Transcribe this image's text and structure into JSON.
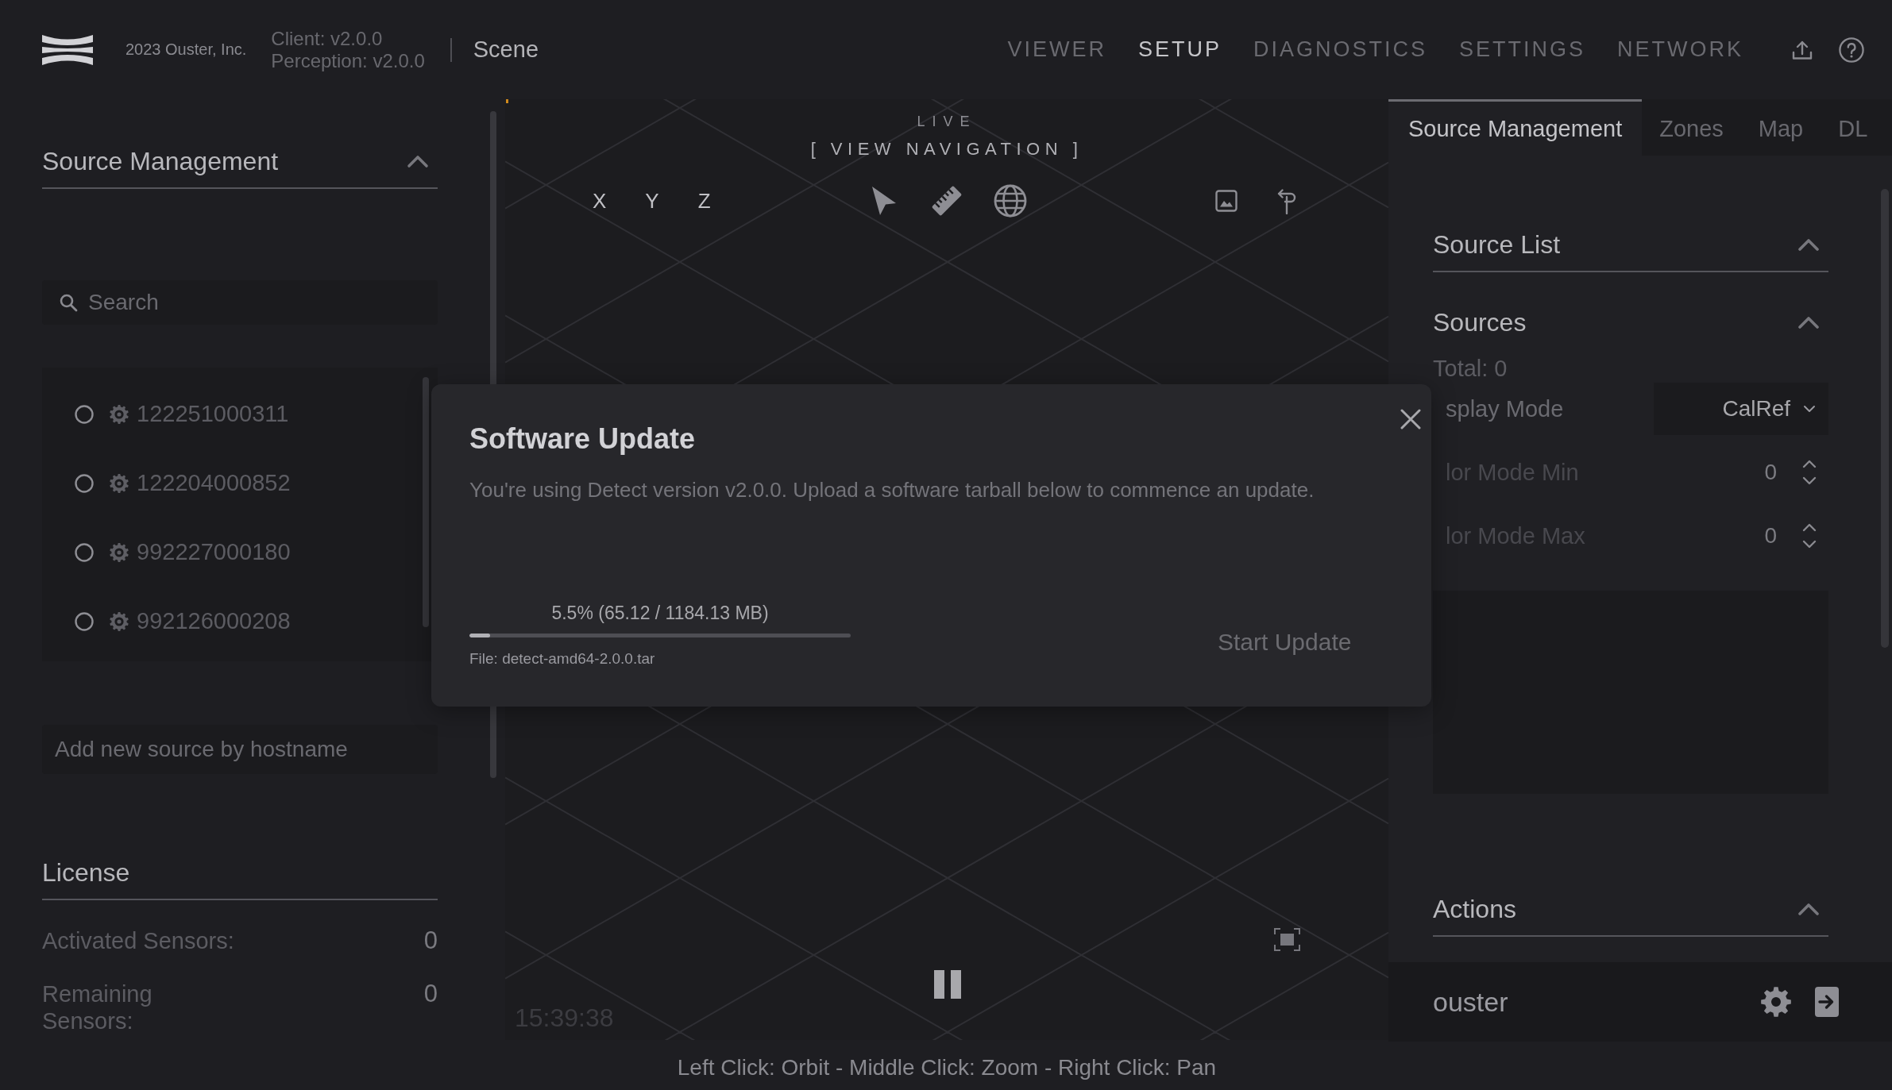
{
  "header": {
    "copyright": "2023 Ouster, Inc.",
    "versions": [
      "Client: v2.0.0",
      "Perception: v2.0.0"
    ],
    "page_title": "Scene",
    "nav": [
      {
        "label": "VIEWER",
        "selected": false
      },
      {
        "label": "SETUP",
        "selected": true
      },
      {
        "label": "DIAGNOSTICS",
        "selected": false
      },
      {
        "label": "SETTINGS",
        "selected": false
      },
      {
        "label": "NETWORK",
        "selected": false
      }
    ]
  },
  "left_panel": {
    "source_management": {
      "title": "Source Management",
      "expanded": true,
      "search": {
        "placeholder": "Search"
      },
      "sources": [
        {
          "label": "122251000311",
          "selected": false
        },
        {
          "label": "122204000852",
          "selected": false
        },
        {
          "label": "992227000180",
          "selected": false
        },
        {
          "label": "992126000208",
          "selected": false
        }
      ],
      "add_source": {
        "placeholder": "Add new source by hostname"
      }
    },
    "license": {
      "title": "License",
      "rows": [
        {
          "label": "Activated Sensors:",
          "value": "0"
        },
        {
          "label": "Remaining Sensors:",
          "value": "0"
        }
      ]
    }
  },
  "viewport": {
    "mode": "LIVE",
    "title": "[ VIEW NAVIGATION ]",
    "axes": [
      "X",
      "Y",
      "Z"
    ],
    "playing": true,
    "timestamp": "15:39:38",
    "hint": "Left Click: Orbit - Middle Click: Zoom - Right Click: Pan"
  },
  "dialog": {
    "title": "Software Update",
    "message": "You're using Detect version v2.0.0. Upload a software tarball below to commence an update.",
    "progress": {
      "reading": "5.5% (65.12 / 1184.13 MB)",
      "level": 0.055
    },
    "file": "File: detect-amd64-2.0.0.tar",
    "action": {
      "label": "Start Update",
      "disabled": true
    }
  },
  "right_panel": {
    "tabs": [
      {
        "label": "Source Management",
        "selected": true
      },
      {
        "label": "Zones",
        "selected": false
      },
      {
        "label": "Map",
        "selected": false
      },
      {
        "label": "DL",
        "selected": false
      }
    ],
    "source_list": {
      "title": "Source List",
      "expanded": true
    },
    "sources": {
      "title": "Sources",
      "expanded": true,
      "total": "Total: 0",
      "fields": [
        {
          "kind": "select",
          "label": "splay Mode",
          "value": "CalRef",
          "disabled": false
        },
        {
          "kind": "number",
          "label": "lor Mode Min",
          "value": "0",
          "disabled": true
        },
        {
          "kind": "number",
          "label": "lor Mode Max",
          "value": "0",
          "disabled": true
        }
      ]
    },
    "actions": {
      "title": "Actions",
      "expanded": true
    },
    "user": {
      "name": "ouster"
    }
  }
}
